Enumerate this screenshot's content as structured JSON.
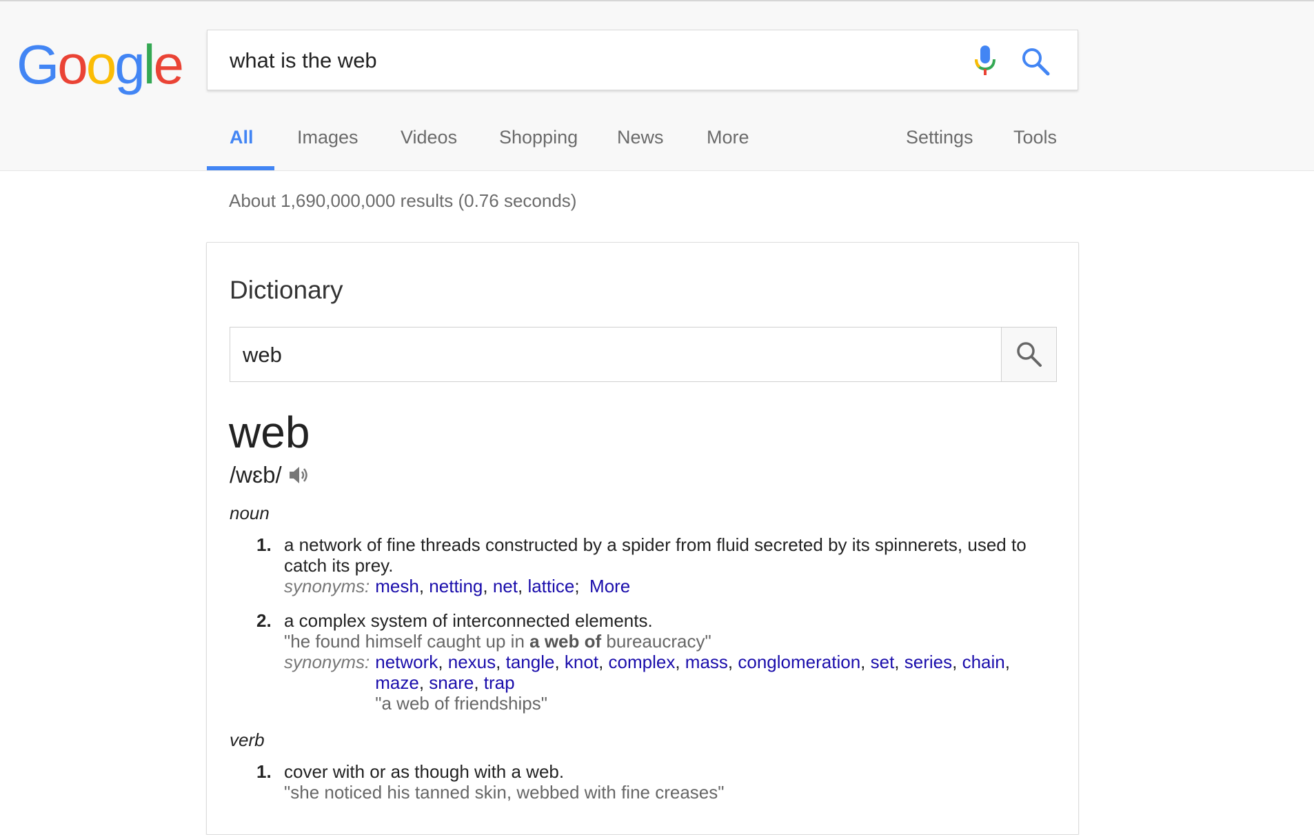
{
  "logo": {
    "text": "Google",
    "letters": [
      "G",
      "o",
      "o",
      "g",
      "l",
      "e"
    ],
    "colors": [
      "#4285f4",
      "#ea4335",
      "#fbbc05",
      "#4285f4",
      "#34a853",
      "#ea4335"
    ]
  },
  "search": {
    "query": "what is the web",
    "mic_icon": "mic-icon",
    "search_icon": "search-icon"
  },
  "tabs": {
    "all": "All",
    "images": "Images",
    "videos": "Videos",
    "shopping": "Shopping",
    "news": "News",
    "more": "More",
    "settings": "Settings",
    "tools": "Tools"
  },
  "results_stats": "About 1,690,000,000 results (0.76 seconds)",
  "dictionary": {
    "title": "Dictionary",
    "search_value": "web",
    "word": "web",
    "phonetic": "/wɛb/",
    "noun": {
      "label": "noun",
      "senses": [
        {
          "num": "1.",
          "definition": "a network of fine threads constructed by a spider from fluid secreted by its spinnerets, used to catch its prey.",
          "synonyms_label": "synonyms:",
          "synonyms": [
            "mesh",
            "netting",
            "net",
            "lattice"
          ],
          "more": "More"
        },
        {
          "num": "2.",
          "definition": "a complex system of interconnected elements.",
          "example_pre": "\"he found himself caught up in ",
          "example_bold": "a web of",
          "example_post": " bureaucracy\"",
          "synonyms_label": "synonyms:",
          "synonyms": [
            "network",
            "nexus",
            "tangle",
            "knot",
            "complex",
            "mass",
            "conglomeration",
            "set",
            "series",
            "chain",
            "maze",
            "snare",
            "trap"
          ],
          "synonym_example": "\"a web of friendships\""
        }
      ]
    },
    "verb": {
      "label": "verb",
      "senses": [
        {
          "num": "1.",
          "definition": "cover with or as though with a web.",
          "example": "\"she noticed his tanned skin, webbed with fine creases\""
        }
      ]
    }
  },
  "colors": {
    "accent": "#4285f4",
    "link": "#1a0dab",
    "header_bg": "#f8f8f8"
  }
}
